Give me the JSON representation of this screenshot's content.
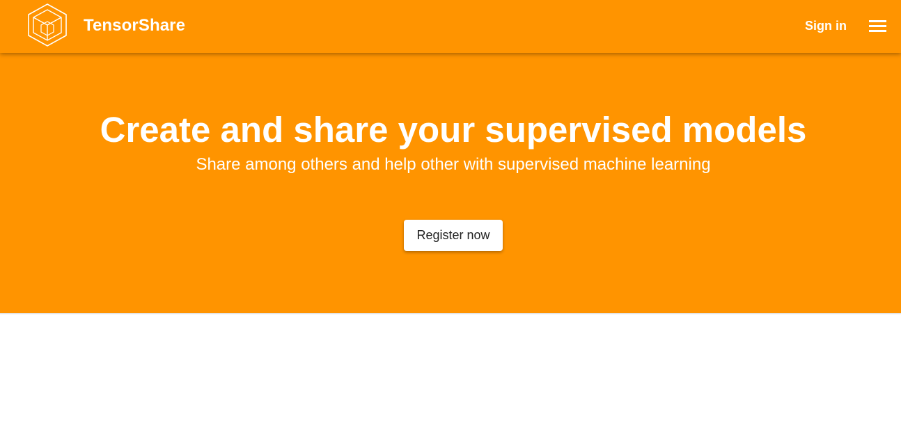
{
  "navbar": {
    "brand_name": "TensorShare",
    "logo_icon": "hexagon-cube-logo-icon",
    "sign_in_label": "Sign in",
    "menu_icon": "hamburger-menu-icon"
  },
  "hero": {
    "title": "Create and share your supervised models",
    "subtitle": "Share among others and help other with supervised machine learning",
    "register_label": "Register now"
  },
  "colors": {
    "brand_orange": "#ff9400",
    "text_light": "#ffffff",
    "button_text": "#222222"
  }
}
